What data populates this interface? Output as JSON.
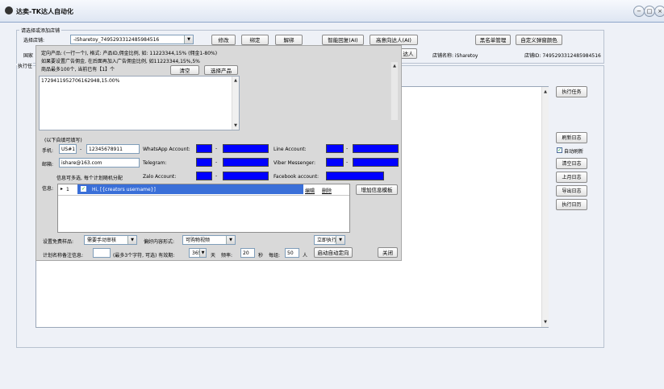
{
  "window": {
    "title": "达卖-TK达人自动化",
    "min_label": "−",
    "max_label": "□",
    "close_label": "×"
  },
  "top": {
    "group_label": "请选择或添加店铺",
    "store_label": "选择店铺:",
    "store_value": "-iSharetoy_7495293312485984516",
    "buttons": [
      "修改",
      "绑定",
      "解绑",
      "智能回复(AI)",
      "高意向达人(AI)",
      "黑名单管理",
      "自定义弹窗颜色"
    ],
    "country_label": "国家",
    "exec_label": "执行任",
    "target_btn_label": "达人",
    "store_name_label": "店铺名称: iSharetoy",
    "store_id_label": "店铺ID: 7495293312485984516"
  },
  "side": {
    "run_task": "执行任务",
    "refresh_log": "刷新日志",
    "auto_refresh": "自动刷新",
    "clear_log": "清空日志",
    "prev_log": "上月日志",
    "export_log": "导出日志",
    "run_history": "执行日历"
  },
  "dialog": {
    "product_hint1": "定向产品: (一行一个), 格式: 产品ID,佣金比例, 如: 11223344,15% (佣金1-80%)",
    "product_hint2": "如果要设置广告佣金, 在后面再加入广告佣金比例, 如11223344,15%,5%",
    "product_count": "商品最多100个, 当前已有【1】个",
    "clear_btn": "清空",
    "select_product_btn": "选择产品",
    "product_text": "1729411952706162948,15.00%",
    "optional_title": "(以下自填可填写)",
    "phone_label": "手机:",
    "phone_code": "US#1",
    "phone_number": "12345678911",
    "email_label": "邮箱:",
    "email_value": "ishare@163.com",
    "whatsapp_label": "WhatsApp Account:",
    "telegram_label": "Telegram:",
    "zalo_label": "Zalo Account:",
    "line_label": "Line Account:",
    "viber_label": "Viber Messenger:",
    "facebook_label": "Facebook account:",
    "info_note": "信息可多选, 每个计划随机分配",
    "info_label": "信息:",
    "row_index": "1",
    "row_message": "Hi, [{creators username}]",
    "edit_link": "编辑",
    "delete_link": "删除",
    "add_template_btn": "增加信息模板",
    "sample_label": "设置免费样品:",
    "sample_value": "需要手动审核",
    "content_label": "偏好内容形式:",
    "content_value": "可购物视频",
    "run_now_label": "立即执行",
    "plan_label": "计划名称备注信息:",
    "plan_hint": "(最多3个字符, 可选) 有效期:",
    "validity_value": "365",
    "days_label": "天",
    "freq_label": "频率:",
    "freq_value": "20",
    "seconds_label": "秒",
    "per_group_label": "每组:",
    "per_group_value": "50",
    "people_label": "人",
    "start_btn": "启动自动定向",
    "close_btn": "关闭"
  },
  "colors": {
    "title_bg": "#dde5f2",
    "dialog_bg": "#d9d9d9",
    "selected_row": "#3a6fd8",
    "blue_field": "#0000ff"
  }
}
